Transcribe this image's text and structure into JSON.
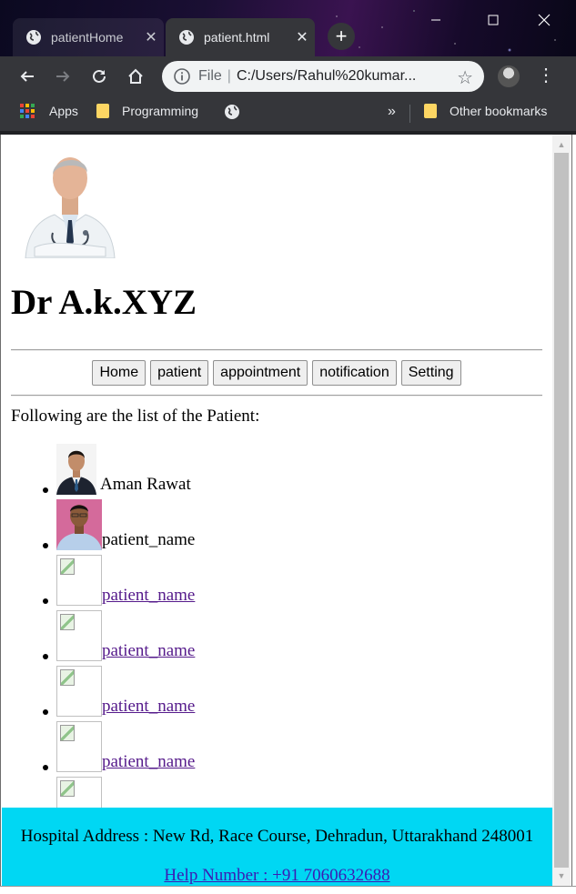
{
  "browser": {
    "tabs": [
      {
        "title": "patientHome",
        "active": false
      },
      {
        "title": "patient.html",
        "active": true
      }
    ],
    "address": {
      "scheme": "File",
      "url": "C:/Users/Rahul%20kumar..."
    },
    "bookmarks": {
      "apps": "Apps",
      "folder1": "Programming",
      "overflow": "»",
      "other": "Other bookmarks"
    }
  },
  "page": {
    "doctor_name": "Dr A.k.XYZ",
    "nav": [
      "Home",
      "patient",
      "appointment",
      "notification",
      "Setting"
    ],
    "intro": "Following are the list of the Patient:",
    "patients": [
      {
        "name": "Aman Rawat",
        "image": "photo-suit",
        "link": false
      },
      {
        "name": "patient_name",
        "image": "photo-shirt",
        "link": false
      },
      {
        "name": "patient_name",
        "image": "broken",
        "link": true
      },
      {
        "name": "patient_name",
        "image": "broken",
        "link": true
      },
      {
        "name": "patient_name",
        "image": "broken",
        "link": true
      },
      {
        "name": "patient_name",
        "image": "broken",
        "link": true
      },
      {
        "name": "",
        "image": "broken",
        "link": false
      }
    ],
    "footer": {
      "address": "Hospital Address : New Rd, Race Course, Dehradun, Uttarakhand 248001",
      "help": "Help Number : +91 7060632688"
    }
  },
  "colors": {
    "footer_bg": "#00d7f3",
    "visited_link": "#551a8b",
    "chrome_bg": "#35363a"
  }
}
